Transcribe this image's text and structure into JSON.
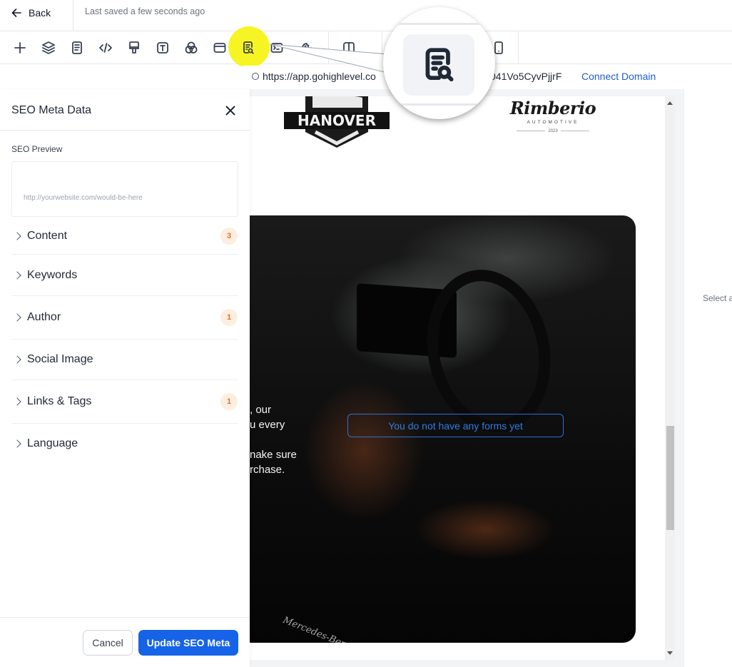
{
  "header": {
    "back_label": "Back",
    "save_status": "Last saved a few seconds ago"
  },
  "toolbar": {
    "tools": [
      {
        "name": "add",
        "icon": "plus-icon"
      },
      {
        "name": "layers",
        "icon": "layers-icon"
      },
      {
        "name": "pages",
        "icon": "page-icon"
      },
      {
        "name": "code",
        "icon": "code-icon"
      },
      {
        "name": "styles",
        "icon": "paint-brush-icon"
      },
      {
        "name": "typography",
        "icon": "text-icon"
      },
      {
        "name": "colors",
        "icon": "color-circles-icon"
      },
      {
        "name": "layout",
        "icon": "browser-window-icon"
      },
      {
        "name": "seo-meta",
        "icon": "seo-document-search-icon",
        "active": true
      },
      {
        "name": "tracking-code",
        "icon": "terminal-icon"
      },
      {
        "name": "cookies",
        "icon": "cookie-icon"
      },
      {
        "name": "desktop-view",
        "icon": "columns-icon"
      },
      {
        "name": "mobile-view",
        "icon": "mobile-icon"
      }
    ],
    "highlight_color": "#f7f318"
  },
  "urlbar": {
    "url_visible_start": "https://app.gohighlevel.co",
    "url_visible_end": "v041Vo5CyvPjjrF",
    "connect_domain_label": "Connect Domain"
  },
  "seo_panel": {
    "title": "SEO Meta Data",
    "preview_label": "SEO Preview",
    "preview_url": "http://yourwebsite.com/would-be-here",
    "sections": [
      {
        "label": "Content",
        "badge": "3"
      },
      {
        "label": "Keywords",
        "badge": null
      },
      {
        "label": "Author",
        "badge": "1"
      },
      {
        "label": "Social Image",
        "badge": null
      },
      {
        "label": "Links & Tags",
        "badge": "1"
      },
      {
        "label": "Language",
        "badge": null
      }
    ],
    "cancel_label": "Cancel",
    "update_label": "Update SEO Meta",
    "accent_color": "#1663e8",
    "badge_color": "#e0732e"
  },
  "canvas": {
    "logo_left_text": "HANOVER",
    "logo_right_name": "Rimberio",
    "logo_right_sub": "AUTOMOTIVE",
    "logo_right_year": "2023",
    "hero_text_lines": [
      ", our",
      "u every",
      "",
      "nake sure",
      "rchase."
    ],
    "forms_placeholder": "You do not have any forms yet",
    "hero_script_text": "Mercedes-Benz"
  },
  "right_panel": {
    "hint": "Select a"
  }
}
